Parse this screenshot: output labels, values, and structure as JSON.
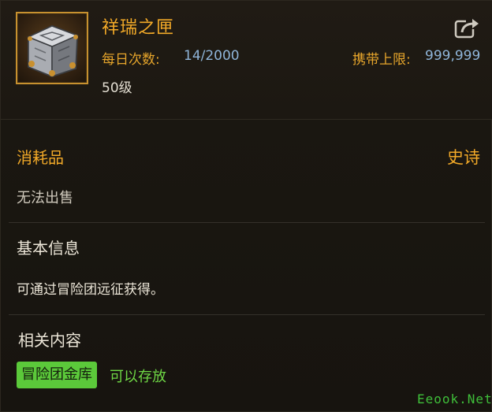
{
  "item": {
    "name": "祥瑞之匣",
    "daily_count_label": "每日次数:",
    "daily_count_value": "14/2000",
    "carry_limit_label": "携带上限:",
    "carry_limit_value": "999,999",
    "level": "50级"
  },
  "details": {
    "category": "消耗品",
    "rarity": "史诗",
    "sell_status": "无法出售"
  },
  "basic_info": {
    "title": "基本信息",
    "text": "可通过冒险团远征获得。"
  },
  "related": {
    "title": "相关内容",
    "tag": "冒险团金库",
    "tag_note": "可以存放"
  },
  "watermark": "Eeook.Net",
  "colors": {
    "gold": "#f2a928",
    "blue_value": "#8fb5d9",
    "green_tag": "#5bc93a",
    "green_text": "#6fd845"
  },
  "icons": {
    "item": "silver-chest-icon",
    "share": "share-export-icon"
  }
}
